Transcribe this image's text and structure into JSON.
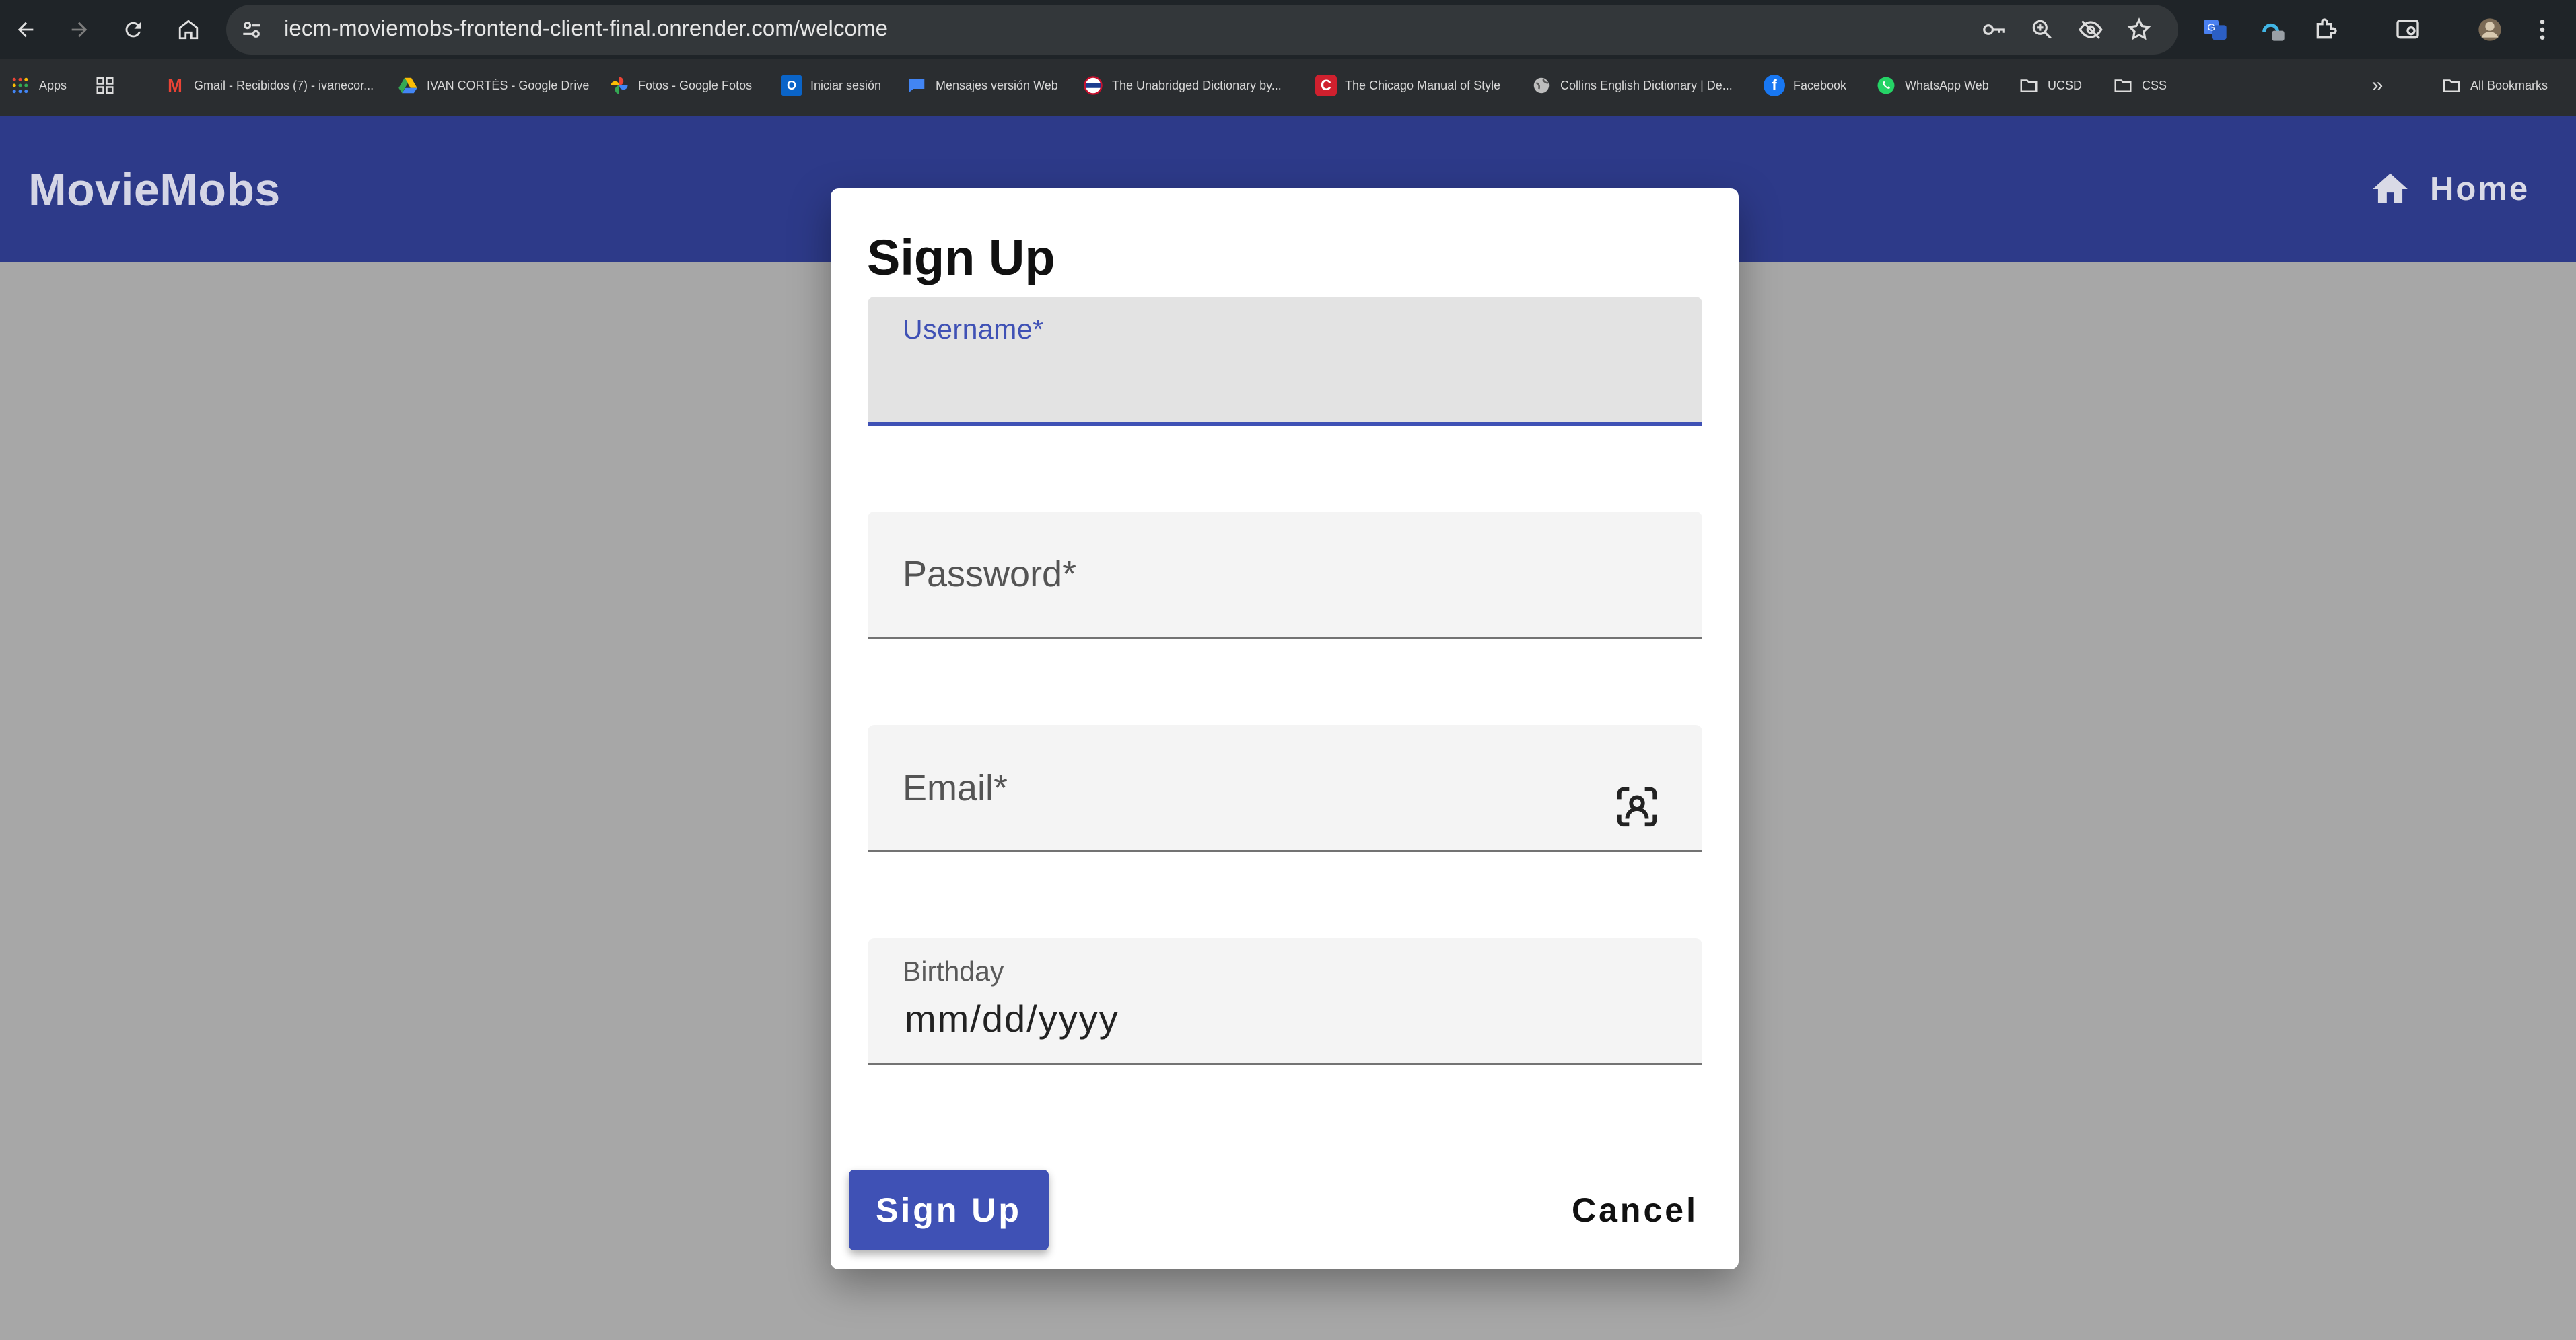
{
  "browser": {
    "url": "iecm-moviemobs-frontend-client-final.onrender.com/welcome",
    "bookmarks": [
      {
        "label": "Apps",
        "icon": "apps-grid-icon"
      },
      {
        "label": "",
        "icon": "tab-groups-icon"
      },
      {
        "label": "Gmail - Recibidos (7) - ivanecor...",
        "icon": "gmail-icon"
      },
      {
        "label": "IVAN CORTÉS - Google Drive",
        "icon": "google-drive-icon"
      },
      {
        "label": "Fotos - Google Fotos",
        "icon": "google-photos-icon"
      },
      {
        "label": "Iniciar sesión",
        "icon": "outlook-icon"
      },
      {
        "label": "Mensajes versión Web",
        "icon": "messages-icon"
      },
      {
        "label": "The Unabridged Dictionary by...",
        "icon": "dictionary-icon"
      },
      {
        "label": "The Chicago Manual of Style",
        "icon": "chicago-manual-icon"
      },
      {
        "label": "Collins English Dictionary | De...",
        "icon": "globe-icon"
      },
      {
        "label": "Facebook",
        "icon": "facebook-icon"
      },
      {
        "label": "WhatsApp Web",
        "icon": "whatsapp-icon"
      },
      {
        "label": "UCSD",
        "icon": "folder-icon"
      },
      {
        "label": "CSS",
        "icon": "folder-icon"
      },
      {
        "label": "All Bookmarks",
        "icon": "folder-icon"
      }
    ]
  },
  "app": {
    "brand": "MovieMobs",
    "nav": {
      "home_label": "Home",
      "home_icon": "home-icon"
    },
    "accent_color": "#3f51b5",
    "appbar_color": "#2d3a89"
  },
  "dialog": {
    "title": "Sign Up",
    "fields": {
      "username": {
        "label": "Username*",
        "value": ""
      },
      "password": {
        "label": "Password*",
        "value": ""
      },
      "email": {
        "label": "Email*",
        "value": "",
        "icon": "contact-picker-icon"
      },
      "birthday": {
        "label": "Birthday",
        "value": "mm/dd/yyyy"
      }
    },
    "submit_label": "Sign Up",
    "cancel_label": "Cancel"
  }
}
